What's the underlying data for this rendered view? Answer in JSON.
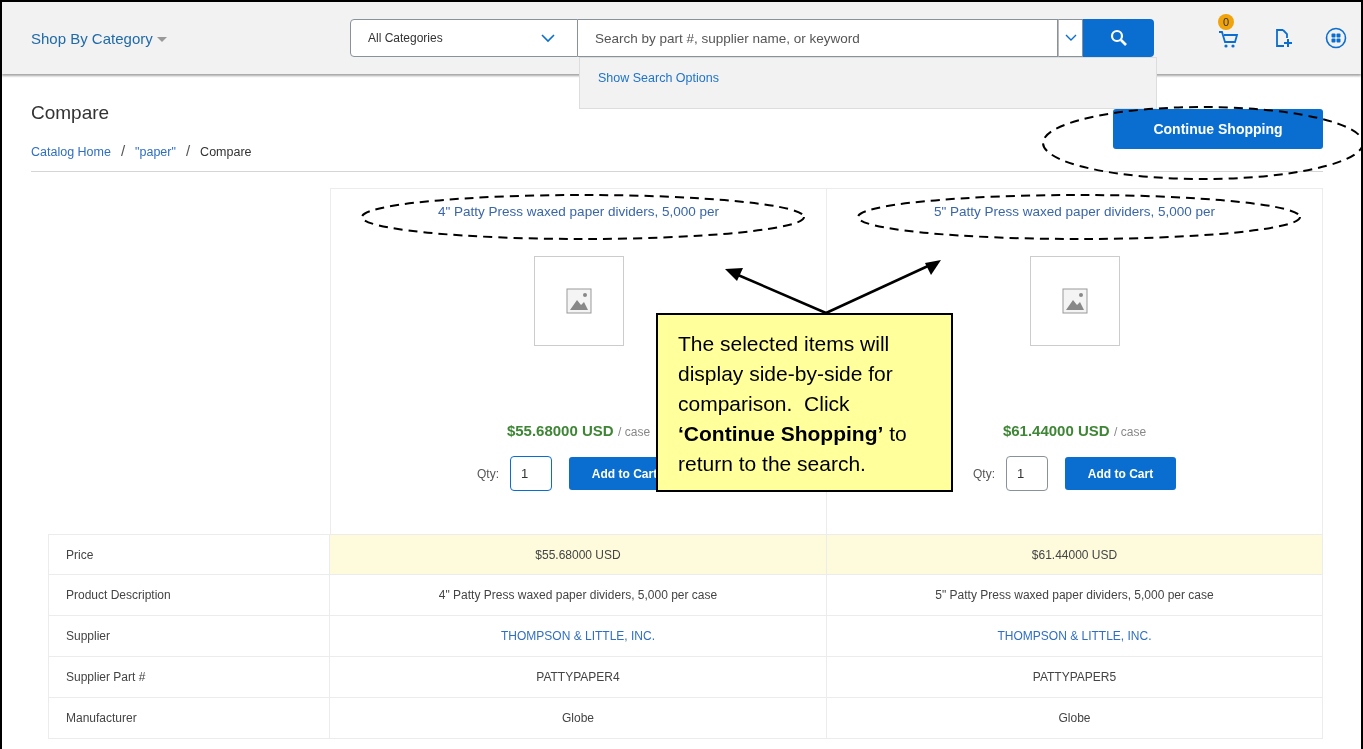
{
  "header": {
    "category_menu": "Shop By Category",
    "category_select": "All Categories",
    "search": {
      "placeholder": "Search by part #, supplier name, or keyword"
    },
    "search_options": "Show Search Options",
    "cart_count": "0"
  },
  "page": {
    "title": "Compare",
    "breadcrumbs": [
      {
        "label": "Catalog Home",
        "link": true
      },
      {
        "label": "\"paper\"",
        "link": true
      },
      {
        "label": "Compare",
        "link": false
      }
    ],
    "separator": "/",
    "continue_button": "Continue Shopping"
  },
  "products": [
    {
      "title": "4\" Patty Press waxed paper dividers, 5,000 per",
      "price": "$55.68000 USD",
      "unit": "/ case",
      "qty_label": "Qty:",
      "qty": "1",
      "focused": true,
      "add_button": "Add to Cart"
    },
    {
      "title": "5\" Patty Press waxed paper dividers, 5,000 per",
      "price": "$61.44000 USD",
      "unit": "/ case",
      "qty_label": "Qty:",
      "qty": "1",
      "focused": false,
      "add_button": "Add to Cart"
    }
  ],
  "rows": [
    {
      "label": "Price",
      "highlighted": true,
      "kind": "text",
      "values": [
        "$55.68000 USD",
        "$61.44000 USD"
      ]
    },
    {
      "label": "Product Description",
      "highlighted": false,
      "kind": "text",
      "values": [
        "4\" Patty Press waxed paper dividers, 5,000 per case",
        "5\" Patty Press waxed paper dividers, 5,000 per case"
      ]
    },
    {
      "label": "Supplier",
      "highlighted": false,
      "kind": "link",
      "values": [
        "THOMPSON & LITTLE, INC.",
        "THOMPSON & LITTLE, INC."
      ]
    },
    {
      "label": "Supplier Part #",
      "highlighted": false,
      "kind": "text",
      "values": [
        "PATTYPAPER4",
        "PATTYPAPER5"
      ]
    },
    {
      "label": "Manufacturer",
      "highlighted": false,
      "kind": "text",
      "values": [
        "Globe",
        "Globe"
      ]
    }
  ],
  "callout": "The selected items will display side-by-side for comparison.  Click **‘Continue Shopping’** to return to the search."
}
